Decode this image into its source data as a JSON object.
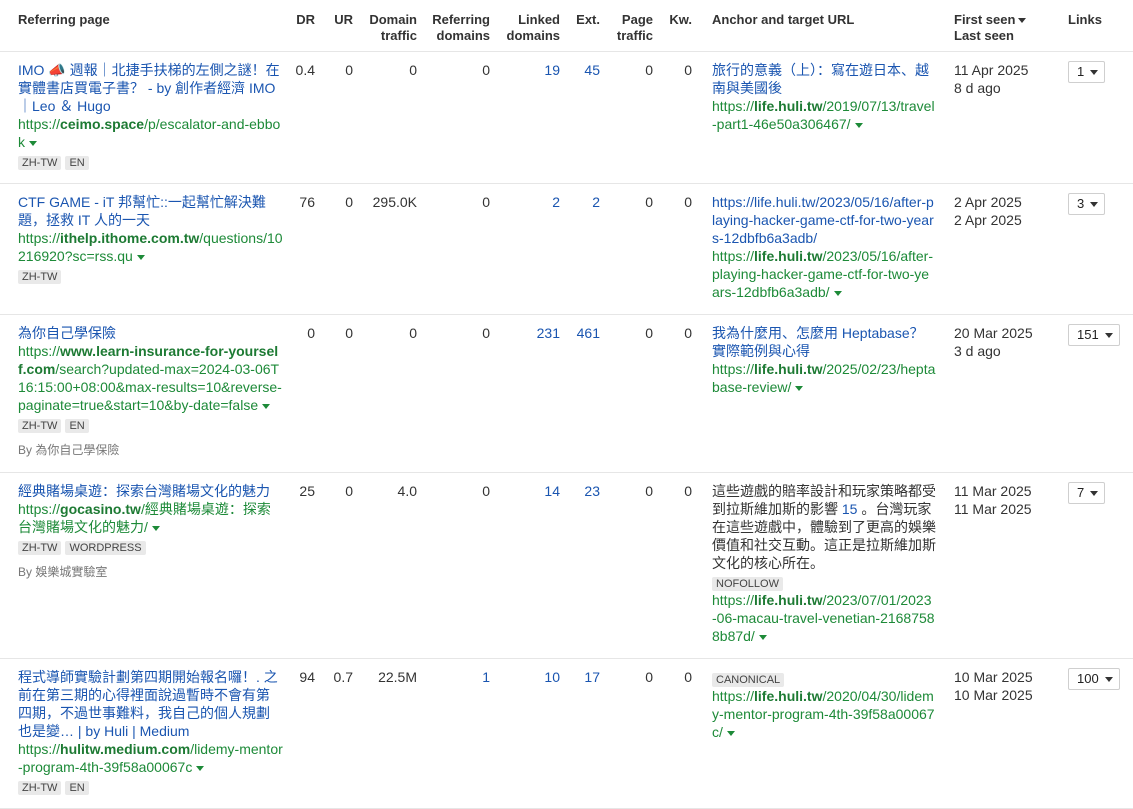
{
  "columns": {
    "referring_page": "Referring page",
    "dr": "DR",
    "ur": "UR",
    "domain_traffic_1": "Domain",
    "domain_traffic_2": "traffic",
    "referring_domains_1": "Referring",
    "referring_domains_2": "domains",
    "linked_domains_1": "Linked",
    "linked_domains_2": "domains",
    "ext": "Ext.",
    "page_traffic_1": "Page",
    "page_traffic_2": "traffic",
    "kw": "Kw.",
    "anchor": "Anchor and target URL",
    "first_seen": "First seen",
    "last_seen": "Last seen",
    "links": "Links"
  },
  "rows": [
    {
      "title": "IMO 📣 週報｜北捷手扶梯的左側之謎！在實體書店買電子書？ - by 創作者經濟 IMO｜Leo ＆ Hugo",
      "url_pre": "https://",
      "url_domain": "ceimo.space",
      "url_path": "/p/escalator-and-ebbok",
      "tags": [
        "ZH-TW",
        "EN"
      ],
      "by": "",
      "dr": "0.4",
      "ur": "0",
      "domain_traffic": "0",
      "referring_domains": "0",
      "linked_domains": "19",
      "ext": "45",
      "page_traffic": "0",
      "kw": "0",
      "anchor_text": "旅行的意義（上）：寫在遊日本、越南與美國後",
      "anchor_is_link": true,
      "anchor_highlight": "",
      "anchor_badges": [],
      "target_pre": "https://",
      "target_domain": "life.huli.tw",
      "target_path": "/2019/07/13/travel-part1-46e50a306467/",
      "first_seen": "11 Apr 2025",
      "last_seen": "8 d ago",
      "links": "1"
    },
    {
      "title": "CTF GAME - iT 邦幫忙::一起幫忙解決難題，拯救 IT 人的一天",
      "url_pre": "https://",
      "url_domain": "ithelp.ithome.com.tw",
      "url_path": "/questions/10216920?sc=rss.qu",
      "tags": [
        "ZH-TW"
      ],
      "by": "",
      "dr": "76",
      "ur": "0",
      "domain_traffic": "295.0K",
      "referring_domains": "0",
      "linked_domains": "2",
      "ext": "2",
      "page_traffic": "0",
      "kw": "0",
      "anchor_text": "https://life.huli.tw/2023/05/16/after-playing-hacker-game-ctf-for-two-years-12dbfb6a3adb/",
      "anchor_is_link": true,
      "anchor_highlight": "",
      "anchor_badges": [],
      "target_pre": "https://",
      "target_domain": "life.huli.tw",
      "target_path": "/2023/05/16/after-playing-hacker-game-ctf-for-two-years-12dbfb6a3adb/",
      "first_seen": "2 Apr 2025",
      "last_seen": "2 Apr 2025",
      "links": "3"
    },
    {
      "title": "為你自己學保險",
      "url_pre": "https://",
      "url_domain": "www.learn-insurance-for-yourself.com",
      "url_path": "/search?updated-max=2024-03-06T16:15:00+08:00&max-results=10&reverse-paginate=true&start=10&by-date=false",
      "tags": [
        "ZH-TW",
        "EN"
      ],
      "by": "By 為你自己學保險",
      "dr": "0",
      "ur": "0",
      "domain_traffic": "0",
      "referring_domains": "0",
      "linked_domains": "231",
      "ext": "461",
      "page_traffic": "0",
      "kw": "0",
      "anchor_text": "我為什麼用、怎麼用 Heptabase？實際範例與心得",
      "anchor_is_link": true,
      "anchor_highlight": "",
      "anchor_badges": [],
      "target_pre": "https://",
      "target_domain": "life.huli.tw",
      "target_path": "/2025/02/23/heptabase-review/",
      "first_seen": "20 Mar 2025",
      "last_seen": "3 d ago",
      "links": "151"
    },
    {
      "title": "經典賭場桌遊：探索台灣賭場文化的魅力",
      "url_pre": "https://",
      "url_domain": "gocasino.tw",
      "url_path": "/經典賭場桌遊：探索台灣賭場文化的魅力/",
      "tags": [
        "ZH-TW",
        "WORDPRESS"
      ],
      "by": "By 娛樂城實驗室",
      "dr": "25",
      "ur": "0",
      "domain_traffic": "4.0",
      "referring_domains": "0",
      "linked_domains": "14",
      "ext": "23",
      "page_traffic": "0",
      "kw": "0",
      "anchor_text": "這些遊戲的賠率設計和玩家策略都受到拉斯維加斯的影響",
      "anchor_is_link": false,
      "anchor_highlight": "15",
      "anchor_suffix": "。台灣玩家在這些遊戲中，體驗到了更高的娛樂價值和社交互動。這正是拉斯維加斯文化的核心所在。",
      "anchor_badges": [
        "NOFOLLOW"
      ],
      "target_pre": "https://",
      "target_domain": "life.huli.tw",
      "target_path": "/2023/07/01/2023-06-macau-travel-venetian-21687588b87d/",
      "first_seen": "11 Mar 2025",
      "last_seen": "11 Mar 2025",
      "links": "7"
    },
    {
      "title": "程式導師實驗計劃第四期開始報名囉！. 之前在第三期的心得裡面說過暫時不會有第四期，不過世事難料，我自己的個人規劃也是變… | by Huli | Medium",
      "url_pre": "https://",
      "url_domain": "hulitw.medium.com",
      "url_path": "/lidemy-mentor-program-4th-39f58a00067c",
      "tags": [
        "ZH-TW",
        "EN"
      ],
      "by": "",
      "dr": "94",
      "ur": "0.7",
      "domain_traffic": "22.5M",
      "referring_domains": "1",
      "linked_domains": "10",
      "ext": "17",
      "page_traffic": "0",
      "kw": "0",
      "anchor_text": "",
      "anchor_is_link": false,
      "anchor_highlight": "",
      "anchor_badges": [
        "CANONICAL"
      ],
      "target_pre": "https://",
      "target_domain": "life.huli.tw",
      "target_path": "/2020/04/30/lidemy-mentor-program-4th-39f58a00067c/",
      "first_seen": "10 Mar 2025",
      "last_seen": "10 Mar 2025",
      "links": "100"
    }
  ],
  "colors": {
    "link": "#1a55b0",
    "url": "#1d8a38",
    "tag_bg": "#e9e9e9",
    "border": "#e6e6e6"
  }
}
